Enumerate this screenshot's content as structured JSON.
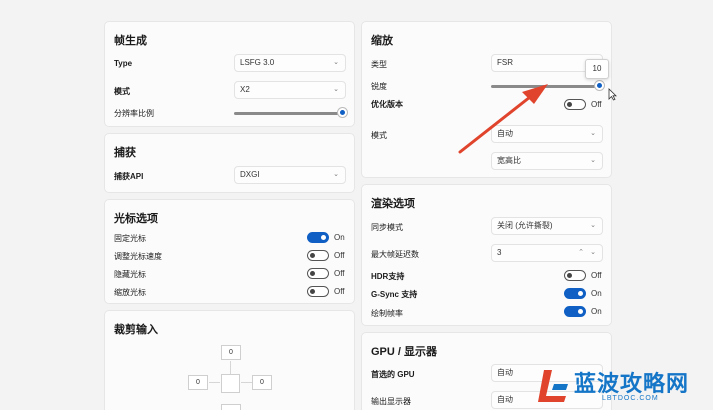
{
  "frame_gen": {
    "title": "帧生成",
    "type_label": "Type",
    "type_value": "LSFG 3.0",
    "mode_label": "模式",
    "mode_value": "X2",
    "resolution_label": "分辨率比例",
    "resolution_fraction": 1.0
  },
  "capture": {
    "title": "捕获",
    "api_label": "捕获API",
    "api_value": "DXGI"
  },
  "cursor": {
    "title": "光标选项",
    "items": [
      {
        "label": "固定光标",
        "state": "On",
        "on": true
      },
      {
        "label": "调整光标速度",
        "state": "Off",
        "on": false
      },
      {
        "label": "隐藏光标",
        "state": "Off",
        "on": false
      },
      {
        "label": "缩放光标",
        "state": "Off",
        "on": false
      }
    ]
  },
  "crop": {
    "title": "裁剪输入",
    "top": "0",
    "left": "0",
    "right": "0"
  },
  "scale": {
    "title": "缩放",
    "type_label": "类型",
    "type_value": "FSR",
    "sharpness_label": "锐度",
    "sharpness_value": "10",
    "sharpness_fraction": 1.0,
    "optimized_label": "优化版本",
    "optimized_state": "Off",
    "mode_label": "模式",
    "mode_value": "自动",
    "aspect_value": "宽高比"
  },
  "render": {
    "title": "渲染选项",
    "sync_label": "同步模式",
    "sync_value": "关闭 (允许撕裂)",
    "latency_label": "最大帧延迟数",
    "latency_value": "3",
    "hdr_label": "HDR支持",
    "hdr_state": "Off",
    "gsync_label": "G-Sync 支持",
    "gsync_state": "On",
    "fps_label": "绘制帧率",
    "fps_state": "On"
  },
  "gpu": {
    "title": "GPU / 显示器",
    "preferred_label": "首选的 GPU",
    "preferred_value": "自动",
    "output_label": "输出显示器",
    "output_value": "自动"
  },
  "watermark": {
    "text": "蓝波攻略网",
    "url": "LBTDOC.COM"
  },
  "colors": {
    "accent": "#0f5fc4",
    "arrow": "#e0442c",
    "watermark": "#1576c8"
  }
}
